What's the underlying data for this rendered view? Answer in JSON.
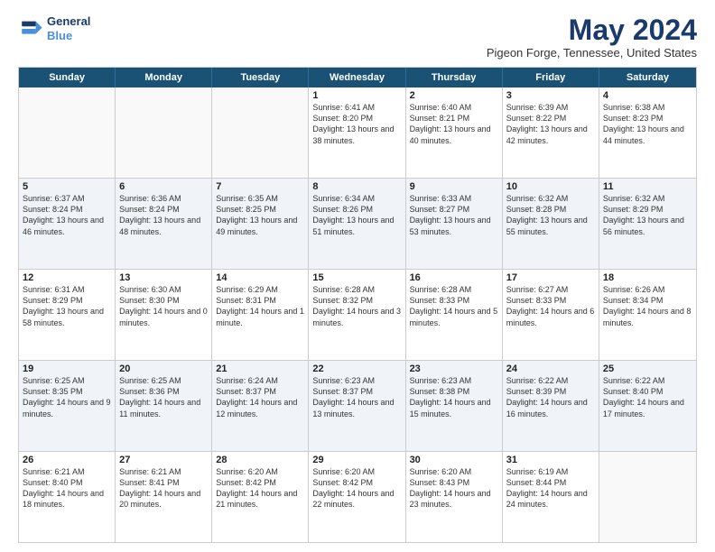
{
  "header": {
    "logo_line1": "General",
    "logo_line2": "Blue",
    "month_title": "May 2024",
    "location": "Pigeon Forge, Tennessee, United States"
  },
  "day_headers": [
    "Sunday",
    "Monday",
    "Tuesday",
    "Wednesday",
    "Thursday",
    "Friday",
    "Saturday"
  ],
  "rows": [
    [
      {
        "day": "",
        "text": "",
        "empty": true
      },
      {
        "day": "",
        "text": "",
        "empty": true
      },
      {
        "day": "",
        "text": "",
        "empty": true
      },
      {
        "day": "1",
        "text": "Sunrise: 6:41 AM\nSunset: 8:20 PM\nDaylight: 13 hours and 38 minutes."
      },
      {
        "day": "2",
        "text": "Sunrise: 6:40 AM\nSunset: 8:21 PM\nDaylight: 13 hours and 40 minutes."
      },
      {
        "day": "3",
        "text": "Sunrise: 6:39 AM\nSunset: 8:22 PM\nDaylight: 13 hours and 42 minutes."
      },
      {
        "day": "4",
        "text": "Sunrise: 6:38 AM\nSunset: 8:23 PM\nDaylight: 13 hours and 44 minutes."
      }
    ],
    [
      {
        "day": "5",
        "text": "Sunrise: 6:37 AM\nSunset: 8:24 PM\nDaylight: 13 hours and 46 minutes."
      },
      {
        "day": "6",
        "text": "Sunrise: 6:36 AM\nSunset: 8:24 PM\nDaylight: 13 hours and 48 minutes."
      },
      {
        "day": "7",
        "text": "Sunrise: 6:35 AM\nSunset: 8:25 PM\nDaylight: 13 hours and 49 minutes."
      },
      {
        "day": "8",
        "text": "Sunrise: 6:34 AM\nSunset: 8:26 PM\nDaylight: 13 hours and 51 minutes."
      },
      {
        "day": "9",
        "text": "Sunrise: 6:33 AM\nSunset: 8:27 PM\nDaylight: 13 hours and 53 minutes."
      },
      {
        "day": "10",
        "text": "Sunrise: 6:32 AM\nSunset: 8:28 PM\nDaylight: 13 hours and 55 minutes."
      },
      {
        "day": "11",
        "text": "Sunrise: 6:32 AM\nSunset: 8:29 PM\nDaylight: 13 hours and 56 minutes."
      }
    ],
    [
      {
        "day": "12",
        "text": "Sunrise: 6:31 AM\nSunset: 8:29 PM\nDaylight: 13 hours and 58 minutes."
      },
      {
        "day": "13",
        "text": "Sunrise: 6:30 AM\nSunset: 8:30 PM\nDaylight: 14 hours and 0 minutes."
      },
      {
        "day": "14",
        "text": "Sunrise: 6:29 AM\nSunset: 8:31 PM\nDaylight: 14 hours and 1 minute."
      },
      {
        "day": "15",
        "text": "Sunrise: 6:28 AM\nSunset: 8:32 PM\nDaylight: 14 hours and 3 minutes."
      },
      {
        "day": "16",
        "text": "Sunrise: 6:28 AM\nSunset: 8:33 PM\nDaylight: 14 hours and 5 minutes."
      },
      {
        "day": "17",
        "text": "Sunrise: 6:27 AM\nSunset: 8:33 PM\nDaylight: 14 hours and 6 minutes."
      },
      {
        "day": "18",
        "text": "Sunrise: 6:26 AM\nSunset: 8:34 PM\nDaylight: 14 hours and 8 minutes."
      }
    ],
    [
      {
        "day": "19",
        "text": "Sunrise: 6:25 AM\nSunset: 8:35 PM\nDaylight: 14 hours and 9 minutes."
      },
      {
        "day": "20",
        "text": "Sunrise: 6:25 AM\nSunset: 8:36 PM\nDaylight: 14 hours and 11 minutes."
      },
      {
        "day": "21",
        "text": "Sunrise: 6:24 AM\nSunset: 8:37 PM\nDaylight: 14 hours and 12 minutes."
      },
      {
        "day": "22",
        "text": "Sunrise: 6:23 AM\nSunset: 8:37 PM\nDaylight: 14 hours and 13 minutes."
      },
      {
        "day": "23",
        "text": "Sunrise: 6:23 AM\nSunset: 8:38 PM\nDaylight: 14 hours and 15 minutes."
      },
      {
        "day": "24",
        "text": "Sunrise: 6:22 AM\nSunset: 8:39 PM\nDaylight: 14 hours and 16 minutes."
      },
      {
        "day": "25",
        "text": "Sunrise: 6:22 AM\nSunset: 8:40 PM\nDaylight: 14 hours and 17 minutes."
      }
    ],
    [
      {
        "day": "26",
        "text": "Sunrise: 6:21 AM\nSunset: 8:40 PM\nDaylight: 14 hours and 18 minutes."
      },
      {
        "day": "27",
        "text": "Sunrise: 6:21 AM\nSunset: 8:41 PM\nDaylight: 14 hours and 20 minutes."
      },
      {
        "day": "28",
        "text": "Sunrise: 6:20 AM\nSunset: 8:42 PM\nDaylight: 14 hours and 21 minutes."
      },
      {
        "day": "29",
        "text": "Sunrise: 6:20 AM\nSunset: 8:42 PM\nDaylight: 14 hours and 22 minutes."
      },
      {
        "day": "30",
        "text": "Sunrise: 6:20 AM\nSunset: 8:43 PM\nDaylight: 14 hours and 23 minutes."
      },
      {
        "day": "31",
        "text": "Sunrise: 6:19 AM\nSunset: 8:44 PM\nDaylight: 14 hours and 24 minutes."
      },
      {
        "day": "",
        "text": "",
        "empty": true
      }
    ]
  ]
}
